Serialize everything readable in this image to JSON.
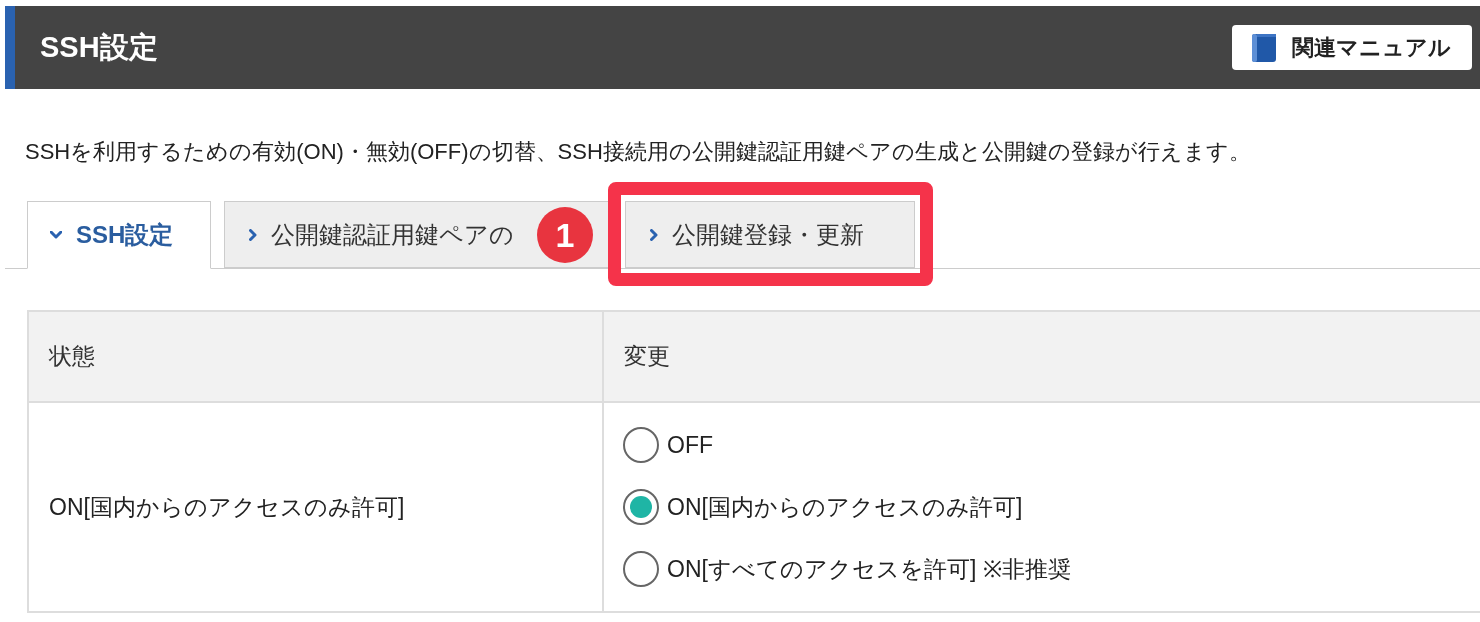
{
  "header": {
    "title": "SSH設定",
    "manual_button": {
      "label": "関連マニュアル"
    }
  },
  "description": "SSHを利用するための有効(ON)・無効(OFF)の切替、SSH接続用の公開鍵認証用鍵ペアの生成と公開鍵の登録が行えます。",
  "tabs": [
    {
      "label": "SSH設定",
      "selected": true,
      "highlighted": false
    },
    {
      "label": "公開鍵認証用鍵ペアの",
      "selected": false,
      "highlighted": false
    },
    {
      "label": "公開鍵登録・更新",
      "selected": false,
      "highlighted": true,
      "step": "1"
    }
  ],
  "table": {
    "columns": [
      "状態",
      "変更"
    ],
    "rows": [
      {
        "status": "ON[国内からのアクセスのみ許可]",
        "options": [
          {
            "label": "OFF",
            "selected": false
          },
          {
            "label": "ON[国内からのアクセスのみ許可]",
            "selected": true
          },
          {
            "label": "ON[すべてのアクセスを許可] ※非推奨",
            "selected": false
          }
        ]
      }
    ]
  }
}
